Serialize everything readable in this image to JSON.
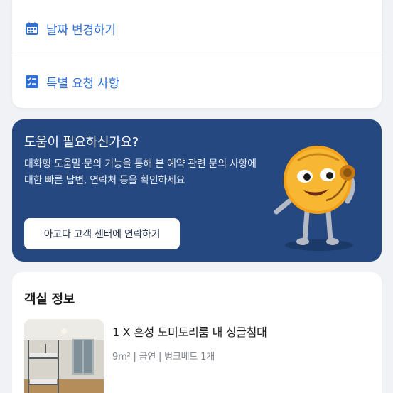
{
  "actions": {
    "change_dates": {
      "label": "날짜 변경하기",
      "icon": "calendar-icon"
    },
    "special_requests": {
      "label": "특별 요청 사항",
      "icon": "checklist-icon"
    }
  },
  "help": {
    "title": "도움이 필요하신가요?",
    "description": "대화형 도움말·문의 기능을 통해 본 예약 관련 문의 사항에 대한 빠른 답변, 연락처 등을 확인하세요",
    "button_label": "아고다 고객 센터에 연락하기",
    "background_color": "#24487f",
    "mascot_icon": "support-mascot-icon"
  },
  "room": {
    "heading": "객실 정보",
    "name": "1 X 혼성 도미토리룸 내 싱글침대",
    "meta": "9m² | 금연 | 벙크베드 1개"
  },
  "colors": {
    "accent": "#2f6fd6",
    "page_bg": "#f1f2f6"
  }
}
